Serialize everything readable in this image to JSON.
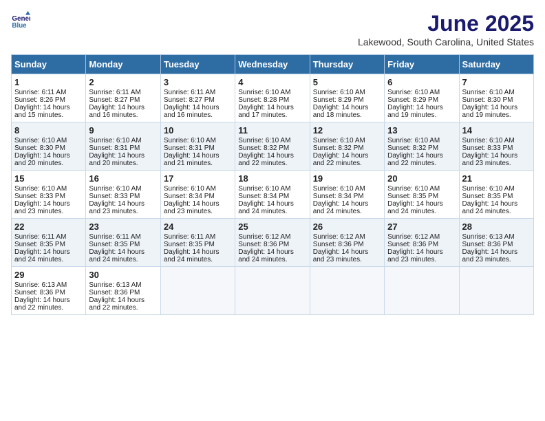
{
  "logo": {
    "line1": "General",
    "line2": "Blue"
  },
  "title": "June 2025",
  "subtitle": "Lakewood, South Carolina, United States",
  "weekdays": [
    "Sunday",
    "Monday",
    "Tuesday",
    "Wednesday",
    "Thursday",
    "Friday",
    "Saturday"
  ],
  "weeks": [
    [
      {
        "day": 1,
        "rise": "6:11 AM",
        "set": "8:26 PM",
        "daylight": "14 hours and 15 minutes."
      },
      {
        "day": 2,
        "rise": "6:11 AM",
        "set": "8:27 PM",
        "daylight": "14 hours and 16 minutes."
      },
      {
        "day": 3,
        "rise": "6:11 AM",
        "set": "8:27 PM",
        "daylight": "14 hours and 16 minutes."
      },
      {
        "day": 4,
        "rise": "6:10 AM",
        "set": "8:28 PM",
        "daylight": "14 hours and 17 minutes."
      },
      {
        "day": 5,
        "rise": "6:10 AM",
        "set": "8:29 PM",
        "daylight": "14 hours and 18 minutes."
      },
      {
        "day": 6,
        "rise": "6:10 AM",
        "set": "8:29 PM",
        "daylight": "14 hours and 19 minutes."
      },
      {
        "day": 7,
        "rise": "6:10 AM",
        "set": "8:30 PM",
        "daylight": "14 hours and 19 minutes."
      }
    ],
    [
      {
        "day": 8,
        "rise": "6:10 AM",
        "set": "8:30 PM",
        "daylight": "14 hours and 20 minutes."
      },
      {
        "day": 9,
        "rise": "6:10 AM",
        "set": "8:31 PM",
        "daylight": "14 hours and 20 minutes."
      },
      {
        "day": 10,
        "rise": "6:10 AM",
        "set": "8:31 PM",
        "daylight": "14 hours and 21 minutes."
      },
      {
        "day": 11,
        "rise": "6:10 AM",
        "set": "8:32 PM",
        "daylight": "14 hours and 22 minutes."
      },
      {
        "day": 12,
        "rise": "6:10 AM",
        "set": "8:32 PM",
        "daylight": "14 hours and 22 minutes."
      },
      {
        "day": 13,
        "rise": "6:10 AM",
        "set": "8:32 PM",
        "daylight": "14 hours and 22 minutes."
      },
      {
        "day": 14,
        "rise": "6:10 AM",
        "set": "8:33 PM",
        "daylight": "14 hours and 23 minutes."
      }
    ],
    [
      {
        "day": 15,
        "rise": "6:10 AM",
        "set": "8:33 PM",
        "daylight": "14 hours and 23 minutes."
      },
      {
        "day": 16,
        "rise": "6:10 AM",
        "set": "8:33 PM",
        "daylight": "14 hours and 23 minutes."
      },
      {
        "day": 17,
        "rise": "6:10 AM",
        "set": "8:34 PM",
        "daylight": "14 hours and 23 minutes."
      },
      {
        "day": 18,
        "rise": "6:10 AM",
        "set": "8:34 PM",
        "daylight": "14 hours and 24 minutes."
      },
      {
        "day": 19,
        "rise": "6:10 AM",
        "set": "8:34 PM",
        "daylight": "14 hours and 24 minutes."
      },
      {
        "day": 20,
        "rise": "6:10 AM",
        "set": "8:35 PM",
        "daylight": "14 hours and 24 minutes."
      },
      {
        "day": 21,
        "rise": "6:10 AM",
        "set": "8:35 PM",
        "daylight": "14 hours and 24 minutes."
      }
    ],
    [
      {
        "day": 22,
        "rise": "6:11 AM",
        "set": "8:35 PM",
        "daylight": "14 hours and 24 minutes."
      },
      {
        "day": 23,
        "rise": "6:11 AM",
        "set": "8:35 PM",
        "daylight": "14 hours and 24 minutes."
      },
      {
        "day": 24,
        "rise": "6:11 AM",
        "set": "8:35 PM",
        "daylight": "14 hours and 24 minutes."
      },
      {
        "day": 25,
        "rise": "6:12 AM",
        "set": "8:36 PM",
        "daylight": "14 hours and 24 minutes."
      },
      {
        "day": 26,
        "rise": "6:12 AM",
        "set": "8:36 PM",
        "daylight": "14 hours and 23 minutes."
      },
      {
        "day": 27,
        "rise": "6:12 AM",
        "set": "8:36 PM",
        "daylight": "14 hours and 23 minutes."
      },
      {
        "day": 28,
        "rise": "6:13 AM",
        "set": "8:36 PM",
        "daylight": "14 hours and 23 minutes."
      }
    ],
    [
      {
        "day": 29,
        "rise": "6:13 AM",
        "set": "8:36 PM",
        "daylight": "14 hours and 22 minutes."
      },
      {
        "day": 30,
        "rise": "6:13 AM",
        "set": "8:36 PM",
        "daylight": "14 hours and 22 minutes."
      },
      null,
      null,
      null,
      null,
      null
    ]
  ]
}
